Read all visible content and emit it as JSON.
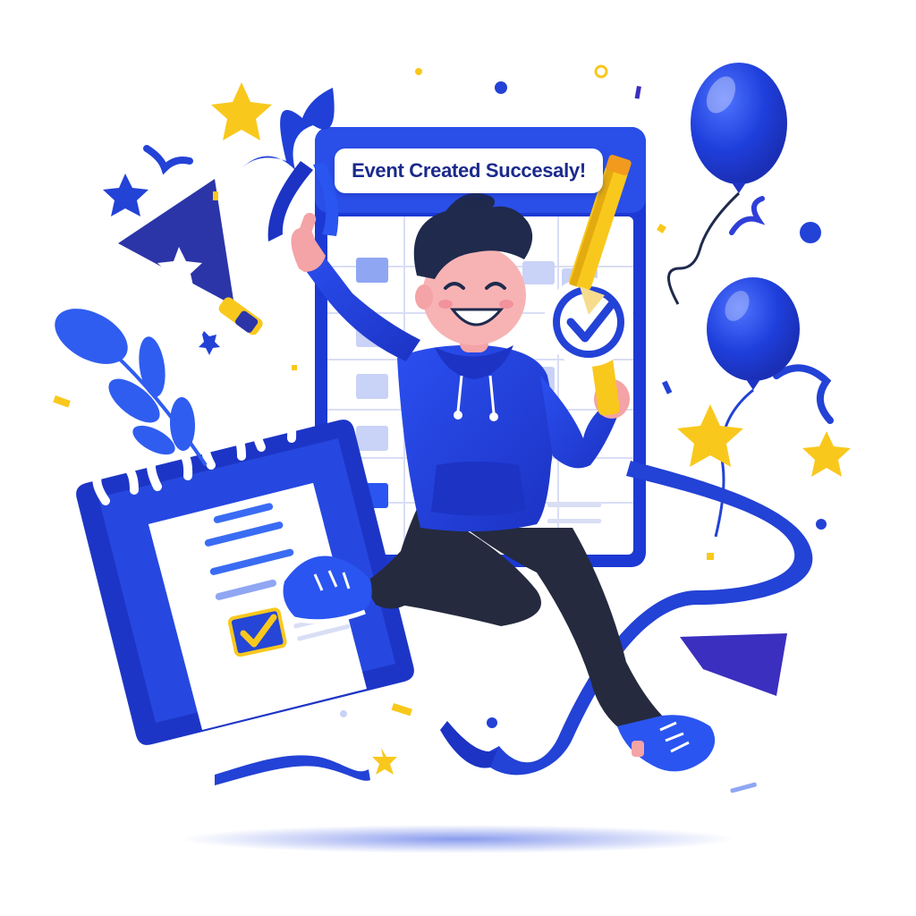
{
  "notification": {
    "message": "Event Created Succesaly!"
  },
  "colors": {
    "primary": "#1e40d8",
    "primary_dark": "#1c2fb0",
    "accent": "#f9c81d",
    "hair": "#1f2a4d",
    "pants": "#252a3e",
    "skin": "#f4a3a6",
    "background": "#ffffff"
  },
  "icons": [
    "calendar-icon",
    "checkmark-icon",
    "pencil-icon",
    "balloon-icon",
    "star-icon",
    "ribbon-icon",
    "party-flag-icon",
    "leaf-icon",
    "confetti-icon"
  ]
}
